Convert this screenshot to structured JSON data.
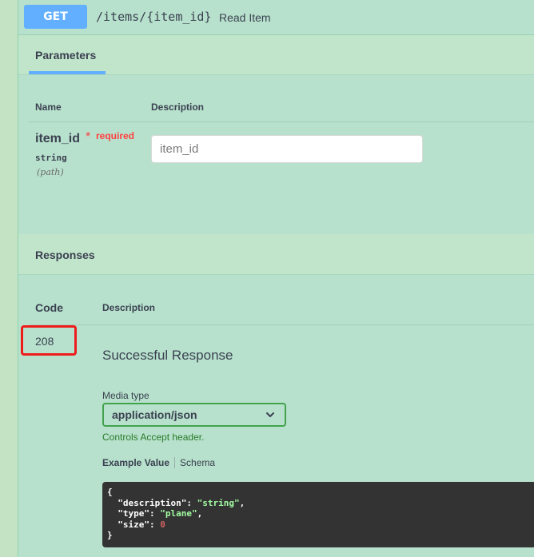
{
  "summary": {
    "method": "GET",
    "path": "/items/{item_id}",
    "description": "Read Item"
  },
  "parameters": {
    "tab_label": "Parameters",
    "columns": {
      "name": "Name",
      "description": "Description"
    },
    "items": [
      {
        "name": "item_id",
        "required_star": "*",
        "required_label": "required",
        "type": "string",
        "in": "(path)",
        "placeholder": "item_id"
      }
    ]
  },
  "responses": {
    "title": "Responses",
    "columns": {
      "code": "Code",
      "description": "Description"
    },
    "items": [
      {
        "code": "208",
        "description": "Successful Response",
        "media_type_label": "Media type",
        "media_type_value": "application/json",
        "controls_note": "Controls Accept header.",
        "tabs": [
          "Example Value",
          "Schema"
        ],
        "example": {
          "open": "{",
          "lines": [
            {
              "key": "\"description\"",
              "sep": ": ",
              "value": "\"string\"",
              "value_type": "string",
              "trail": ","
            },
            {
              "key": "\"type\"",
              "sep": ": ",
              "value": "\"plane\"",
              "value_type": "string",
              "trail": ","
            },
            {
              "key": "\"size\"",
              "sep": ": ",
              "value": "0",
              "value_type": "number",
              "trail": ""
            }
          ],
          "close": "}"
        }
      }
    ]
  },
  "colors": {
    "get_method": "#61affe",
    "required": "#ff4040",
    "highlight": "#ee1c1c",
    "select_border": "#41a34c",
    "code_bg": "#333333",
    "code_string": "#a2fca2",
    "code_number": "#d36363"
  },
  "icons": {
    "select_chevron": "chevron-down-icon"
  }
}
